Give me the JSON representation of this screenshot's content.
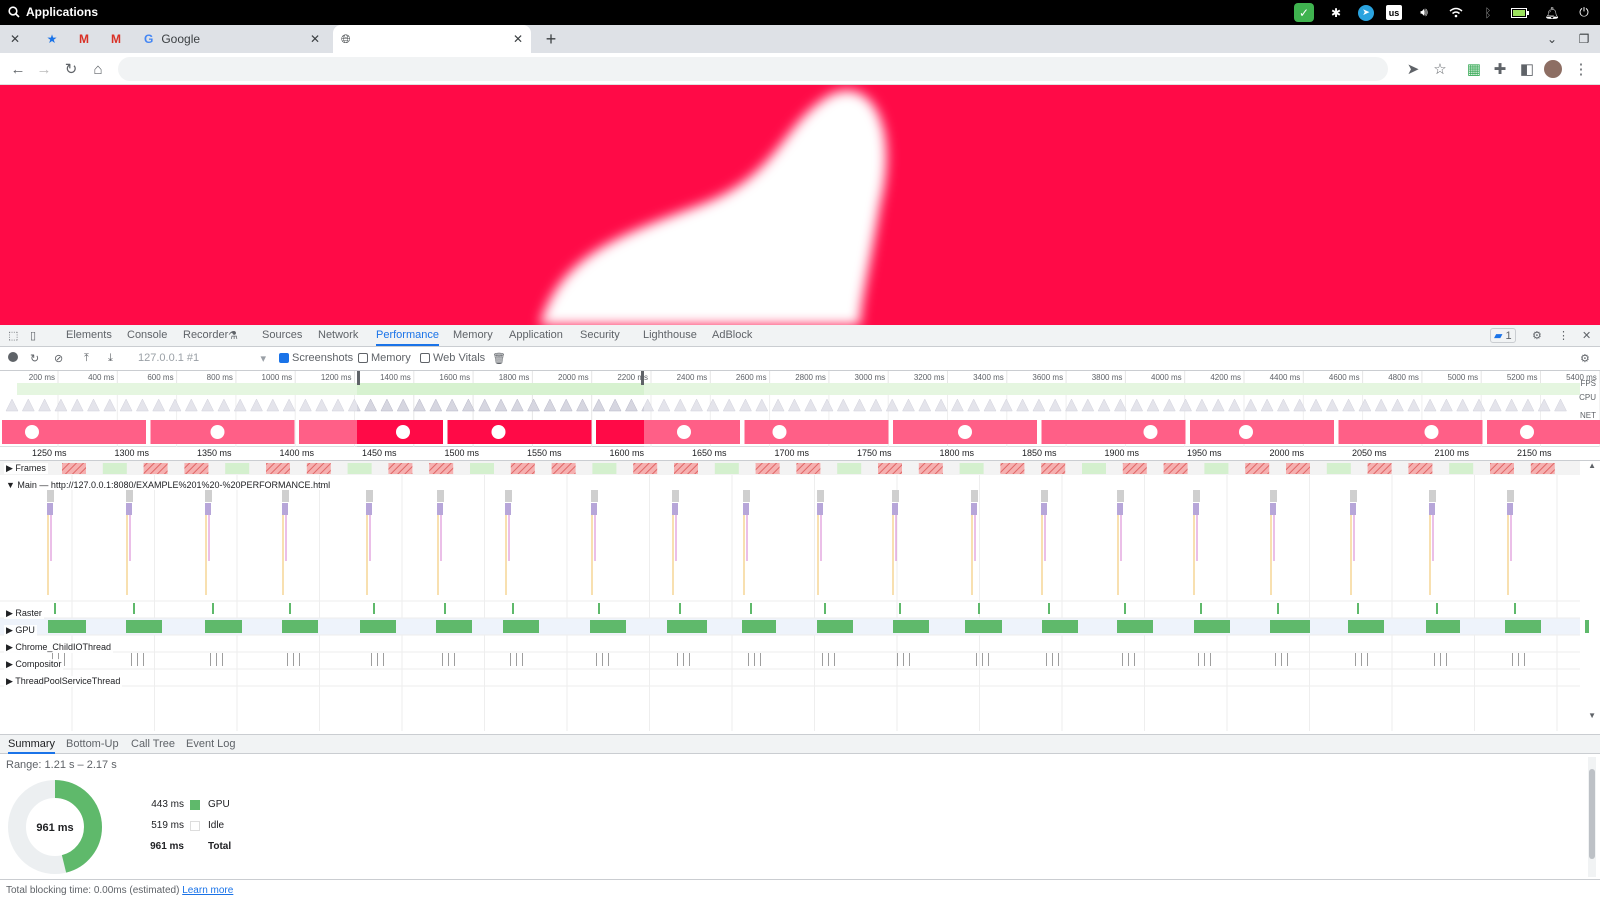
{
  "os": {
    "launcher_label": "Applications",
    "keyboard_layout": "us"
  },
  "browser": {
    "tabs": [
      {
        "title": "",
        "icon": "gmail-icon"
      },
      {
        "title": "",
        "icon": "gmail-icon"
      },
      {
        "title": "Google",
        "icon": "google-icon"
      },
      {
        "title": "",
        "icon": "globe-icon"
      }
    ]
  },
  "devtools": {
    "tabs": [
      "Elements",
      "Console",
      "Recorder",
      "Sources",
      "Network",
      "Performance",
      "Memory",
      "Application",
      "Security",
      "Lighthouse",
      "AdBlock"
    ],
    "active_tab": "Performance",
    "issues_count": "1",
    "perf_toolbar": {
      "profile_select": "127.0.0.1 #1",
      "screenshots_label": "Screenshots",
      "memory_label": "Memory",
      "web_vitals_label": "Web Vitals"
    },
    "overview_ticks": [
      "200 ms",
      "400 ms",
      "600 ms",
      "800 ms",
      "1000 ms",
      "1200 ms",
      "1400 ms",
      "1600 ms",
      "1800 ms",
      "2000 ms",
      "2200 ms",
      "2400 ms",
      "2600 ms",
      "2800 ms",
      "3000 ms",
      "3200 ms",
      "3400 ms",
      "3600 ms",
      "3800 ms",
      "4000 ms",
      "4200 ms",
      "4400 ms",
      "4600 ms",
      "4800 ms",
      "5000 ms",
      "5200 ms",
      "5400 ms"
    ],
    "overview_labels": {
      "fps": "FPS",
      "cpu": "CPU",
      "net": "NET"
    },
    "detail_ticks": [
      "1250 ms",
      "1300 ms",
      "1350 ms",
      "1400 ms",
      "1450 ms",
      "1500 ms",
      "1550 ms",
      "1600 ms",
      "1650 ms",
      "1700 ms",
      "1750 ms",
      "1800 ms",
      "1850 ms",
      "1900 ms",
      "1950 ms",
      "2000 ms",
      "2050 ms",
      "2100 ms",
      "2150 ms"
    ],
    "tracks": {
      "frames": "Frames",
      "main": "Main — http://127.0.0.1:8080/EXAMPLE%201%20-%20PERFORMANCE.html",
      "raster": "Raster",
      "gpu": "GPU",
      "io": "Chrome_ChildIOThread",
      "compositor": "Compositor",
      "threadpool": "ThreadPoolServiceThread"
    },
    "bottom_tabs": [
      "Summary",
      "Bottom-Up",
      "Call Tree",
      "Event Log"
    ],
    "summary": {
      "range": "Range: 1.21 s – 2.17 s",
      "total_center": "961 ms",
      "rows": [
        {
          "value": "443 ms",
          "label": "GPU",
          "color": "#5fb96b",
          "fraction": 0.461
        },
        {
          "value": "519 ms",
          "label": "Idle",
          "color": "#ffffff",
          "fraction": 0.539
        },
        {
          "value": "961 ms",
          "label": "Total",
          "bold": true
        }
      ]
    },
    "footer_text": "Total blocking time: 0.00ms (estimated)",
    "footer_link": "Learn more"
  },
  "colors": {
    "page_bg": "#ff0a47",
    "accent": "#1a73e8",
    "gpu": "#5fb96b",
    "frame_dropped": "#f08c8c"
  }
}
